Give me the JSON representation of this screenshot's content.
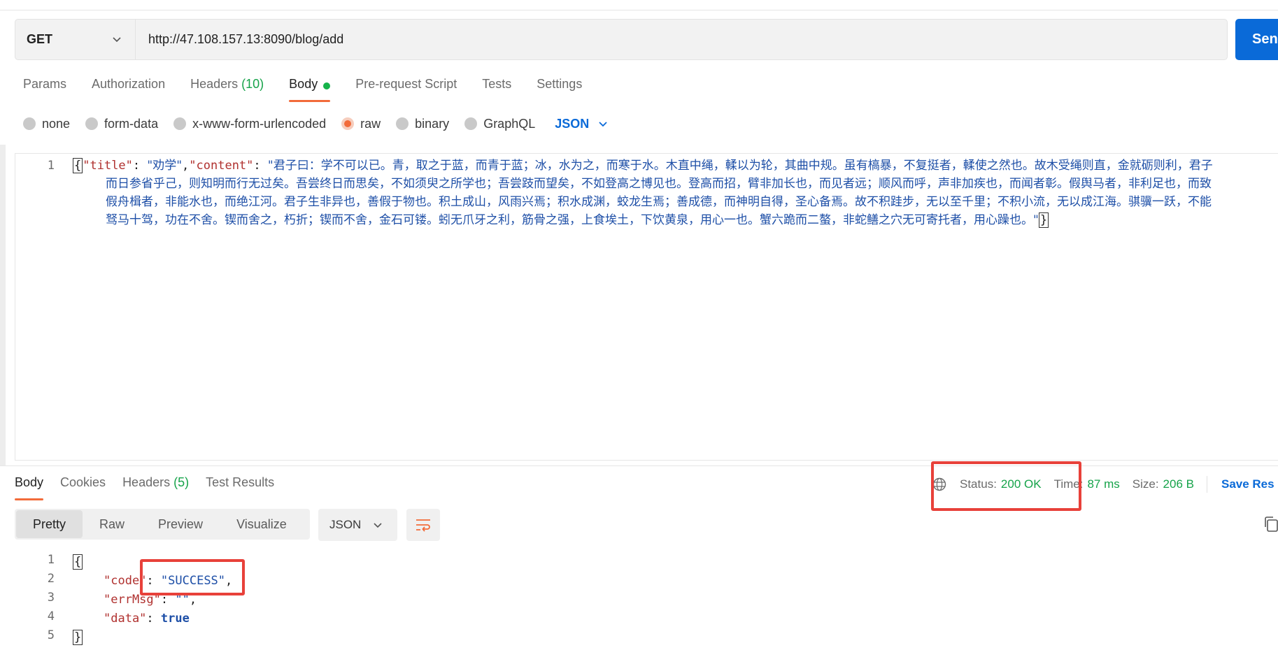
{
  "request": {
    "method": "GET",
    "url": "http://47.108.157.13:8090/blog/add",
    "send_label": "Sen"
  },
  "request_tabs": [
    {
      "label": "Params"
    },
    {
      "label": "Authorization"
    },
    {
      "label": "Headers",
      "count": "(10)"
    },
    {
      "label": "Body"
    },
    {
      "label": "Pre-request Script"
    },
    {
      "label": "Tests"
    },
    {
      "label": "Settings"
    }
  ],
  "body_types": [
    "none",
    "form-data",
    "x-www-form-urlencoded",
    "raw",
    "binary",
    "GraphQL"
  ],
  "body_selected": "raw",
  "body_language": "JSON",
  "request_body": {
    "line_number": "1",
    "key_title": "\"title\"",
    "val_title": "\"劝学\"",
    "key_content": "\"content\"",
    "val_line1": "\"君子曰：学不可以已。青，取之于蓝，而青于蓝；冰，水为之，而寒于水。木直中绳，輮以为轮，其曲中规。虽有槁暴，不复挺者，輮使之然也。故木受绳则直，金就砺则利，君子",
    "val_line2": "而日参省乎己，则知明而行无过矣。吾尝终日而思矣，不如须臾之所学也；吾尝跂而望矣，不如登高之博见也。登高而招，臂非加长也，而见者远；顺风而呼，声非加疾也，而闻者彰。假舆马者，非利足也，而致",
    "val_line3": "假舟楫者，非能水也，而绝江河。君子生非异也，善假于物也。积土成山，风雨兴焉；积水成渊，蛟龙生焉；善成德，而神明自得，圣心备焉。故不积跬步，无以至千里；不积小流，无以成江海。骐骥一跃，不能",
    "val_line4": "驽马十驾，功在不舍。锲而舍之，朽折；锲而不舍，金石可镂。蚓无爪牙之利，筋骨之强，上食埃土，下饮黄泉，用心一也。蟹六跪而二螯，非蛇鳝之穴无可寄托者，用心躁也。\""
  },
  "response_tabs": [
    {
      "label": "Body"
    },
    {
      "label": "Cookies"
    },
    {
      "label": "Headers",
      "count": "(5)"
    },
    {
      "label": "Test Results"
    }
  ],
  "status": {
    "status_label": "Status:",
    "status_value": "200 OK",
    "time_label": "Time:",
    "time_value": "87 ms",
    "size_label": "Size:",
    "size_value": "206 B",
    "save_label": "Save Res"
  },
  "view_modes": [
    "Pretty",
    "Raw",
    "Preview",
    "Visualize"
  ],
  "response_format": "JSON",
  "response_body": {
    "line_numbers": [
      "1",
      "2",
      "3",
      "4",
      "5"
    ],
    "open": "{",
    "k1": "\"code\"",
    "v1": "\"SUCCESS\"",
    "k2": "\"errMsg\"",
    "v2": "\"\"",
    "k3": "\"data\"",
    "v3": "true",
    "close": "}"
  },
  "colors": {
    "accent_orange": "#f26b3a",
    "brand_blue": "#0a6ad8",
    "status_green": "#16a34a",
    "highlight_red": "#e8413a"
  }
}
